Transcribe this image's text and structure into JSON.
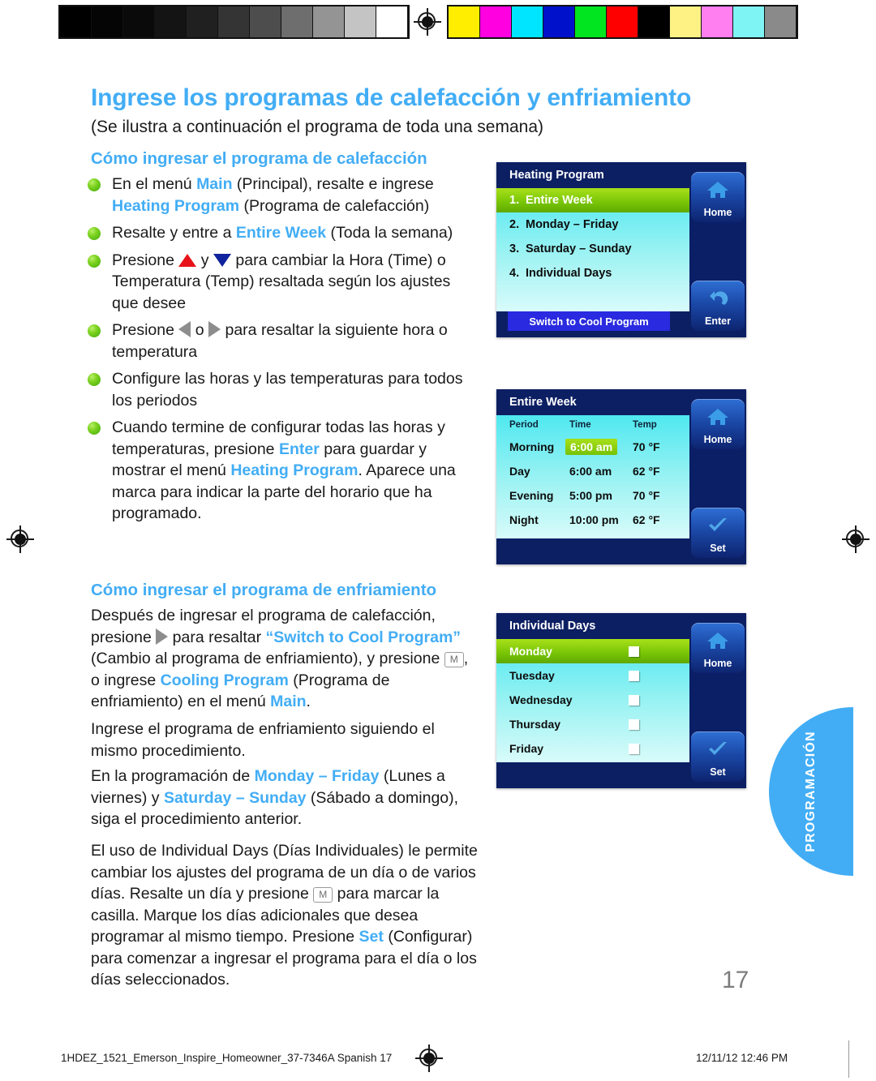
{
  "calibration": {
    "grays": [
      "#000000",
      "#050505",
      "#0a0a0a",
      "#141414",
      "#202020",
      "#343434",
      "#4d4d4d",
      "#6e6e6e",
      "#949494",
      "#c4c4c4",
      "#ffffff"
    ],
    "colors": [
      "#ffee00",
      "#ff00e0",
      "#00e5ff",
      "#0011cc",
      "#00e520",
      "#ff0000",
      "#000000",
      "#fff285",
      "#ff7ef0",
      "#7ff4f4",
      "#8a8a8a"
    ]
  },
  "heading": {
    "title": "Ingrese los programas de calefacción y enfriamiento",
    "subtitle": "(Se ilustra a continuación el programa de toda una semana)",
    "section_heating": "Cómo ingresar el programa de calefacción",
    "section_cooling": "Cómo ingresar el programa de enfriamiento"
  },
  "bullets": [
    {
      "parts": [
        {
          "t": "En el menú ",
          "s": "plain"
        },
        {
          "t": "Main",
          "s": "blue"
        },
        {
          "t": " (Principal), resalte e ingrese ",
          "s": "plain"
        },
        {
          "t": "Heating Program",
          "s": "blue"
        },
        {
          "t": " (Programa de calefacción)",
          "s": "plain"
        }
      ]
    },
    {
      "parts": [
        {
          "t": "Resalte y entre a ",
          "s": "plain"
        },
        {
          "t": "Entire Week",
          "s": "blue"
        },
        {
          "t": " (Toda la semana)",
          "s": "plain"
        }
      ]
    },
    {
      "parts": [
        {
          "t": "Presione ",
          "s": "plain"
        },
        {
          "t": "",
          "s": "tri-up"
        },
        {
          "t": " y ",
          "s": "plain"
        },
        {
          "t": "",
          "s": "tri-dn"
        },
        {
          "t": " para cambiar la Hora (Time) o Temperatura (Temp) resaltada según los ajustes que desee",
          "s": "plain"
        }
      ]
    },
    {
      "parts": [
        {
          "t": "Presione ",
          "s": "plain"
        },
        {
          "t": "",
          "s": "tri-lf"
        },
        {
          "t": " o ",
          "s": "plain"
        },
        {
          "t": "",
          "s": "tri-rt"
        },
        {
          "t": " para resaltar la siguiente hora o temperatura",
          "s": "plain"
        }
      ]
    },
    {
      "parts": [
        {
          "t": "Configure las horas y las temperaturas para todos los periodos",
          "s": "plain"
        }
      ]
    },
    {
      "parts": [
        {
          "t": "Cuando termine de configurar todas las horas y temperaturas, presione ",
          "s": "plain"
        },
        {
          "t": "Enter",
          "s": "blue"
        },
        {
          "t": " para guardar y mostrar el menú ",
          "s": "plain"
        },
        {
          "t": "Heating Program",
          "s": "blue"
        },
        {
          "t": ". Aparece una marca para indicar la parte del horario que ha programado.",
          "s": "plain"
        }
      ]
    }
  ],
  "paragraphs": {
    "cooling": [
      {
        "t": "Después de ingresar el programa de calefacción, presione ",
        "s": "plain"
      },
      {
        "t": "",
        "s": "tri-rt"
      },
      {
        "t": " para resaltar ",
        "s": "plain"
      },
      {
        "t": "“Switch to Cool Program”",
        "s": "blue"
      },
      {
        "t": " (Cambio al programa de enfriamiento), y presione ",
        "s": "plain"
      },
      {
        "t": "M",
        "s": "mkey"
      },
      {
        "t": ", o ingrese ",
        "s": "plain"
      },
      {
        "t": "Cooling Program",
        "s": "blue"
      },
      {
        "t": " (Programa de enfriamiento) en el menú ",
        "s": "plain"
      },
      {
        "t": "Main",
        "s": "blue"
      },
      {
        "t": ".",
        "s": "plain"
      }
    ],
    "same_procedure": [
      {
        "t": "Ingrese el programa de enfriamiento siguiendo el mismo procedimiento.",
        "s": "plain"
      }
    ],
    "mon_fri": [
      {
        "t": "En la programación de ",
        "s": "plain"
      },
      {
        "t": "Monday – Friday",
        "s": "blue"
      },
      {
        "t": " (Lunes a viernes) y ",
        "s": "plain"
      },
      {
        "t": "Saturday – Sunday",
        "s": "blue"
      },
      {
        "t": " (Sábado a domingo), siga el procedimiento anterior.",
        "s": "plain"
      }
    ],
    "individual": [
      {
        "t": "El uso de Individual Days (Días Individuales) le permite cambiar los ajustes del programa de un día o de varios días. Resalte un día y presione ",
        "s": "plain"
      },
      {
        "t": "M",
        "s": "mkey"
      },
      {
        "t": " para marcar la casilla. Marque los días adicionales que desea programar al mismo tiempo. Presione ",
        "s": "plain"
      },
      {
        "t": "Set",
        "s": "blue"
      },
      {
        "t": " (Configurar) para comenzar a ingresar el programa para el día o los días seleccionados.",
        "s": "plain"
      }
    ]
  },
  "screens": {
    "heating_program": {
      "title": "Heating Program",
      "items": [
        {
          "num": "1.",
          "label": "Entire Week",
          "selected": true
        },
        {
          "num": "2.",
          "label": "Monday – Friday",
          "selected": false
        },
        {
          "num": "3.",
          "label": "Saturday – Sunday",
          "selected": false
        },
        {
          "num": "4.",
          "label": "Individual Days",
          "selected": false
        }
      ],
      "switch_button": "Switch to Cool Program",
      "home_button": "Home",
      "enter_button": "Enter"
    },
    "entire_week": {
      "title": "Entire Week",
      "columns": [
        "Period",
        "Time",
        "Temp"
      ],
      "rows": [
        {
          "period": "Morning",
          "time": "6:00 am",
          "temp": "70 °F",
          "highlight": "time"
        },
        {
          "period": "Day",
          "time": "6:00 am",
          "temp": "62 °F",
          "highlight": ""
        },
        {
          "period": "Evening",
          "time": "5:00 pm",
          "temp": "70 °F",
          "highlight": ""
        },
        {
          "period": "Night",
          "time": "10:00 pm",
          "temp": "62 °F",
          "highlight": ""
        }
      ],
      "home_button": "Home",
      "set_button": "Set"
    },
    "individual_days": {
      "title": "Individual Days",
      "days": [
        {
          "label": "Monday",
          "selected": true,
          "checked": false
        },
        {
          "label": "Tuesday",
          "selected": false,
          "checked": false
        },
        {
          "label": "Wednesday",
          "selected": false,
          "checked": false
        },
        {
          "label": "Thursday",
          "selected": false,
          "checked": false
        },
        {
          "label": "Friday",
          "selected": false,
          "checked": false
        }
      ],
      "home_button": "Home",
      "set_button": "Set"
    }
  },
  "side_tab": {
    "label": "PROGRAMACIÓN"
  },
  "page_number": "17",
  "footer": {
    "left": "1HDEZ_1521_Emerson_Inspire_Homeowner_37-7346A Spanish   17",
    "right": "12/11/12   12:46 PM"
  },
  "colors": {
    "accent": "#42adf5",
    "bullet": "#7ed321",
    "screen_dark": "#0c1f63",
    "highlight_green": "#77c406"
  }
}
